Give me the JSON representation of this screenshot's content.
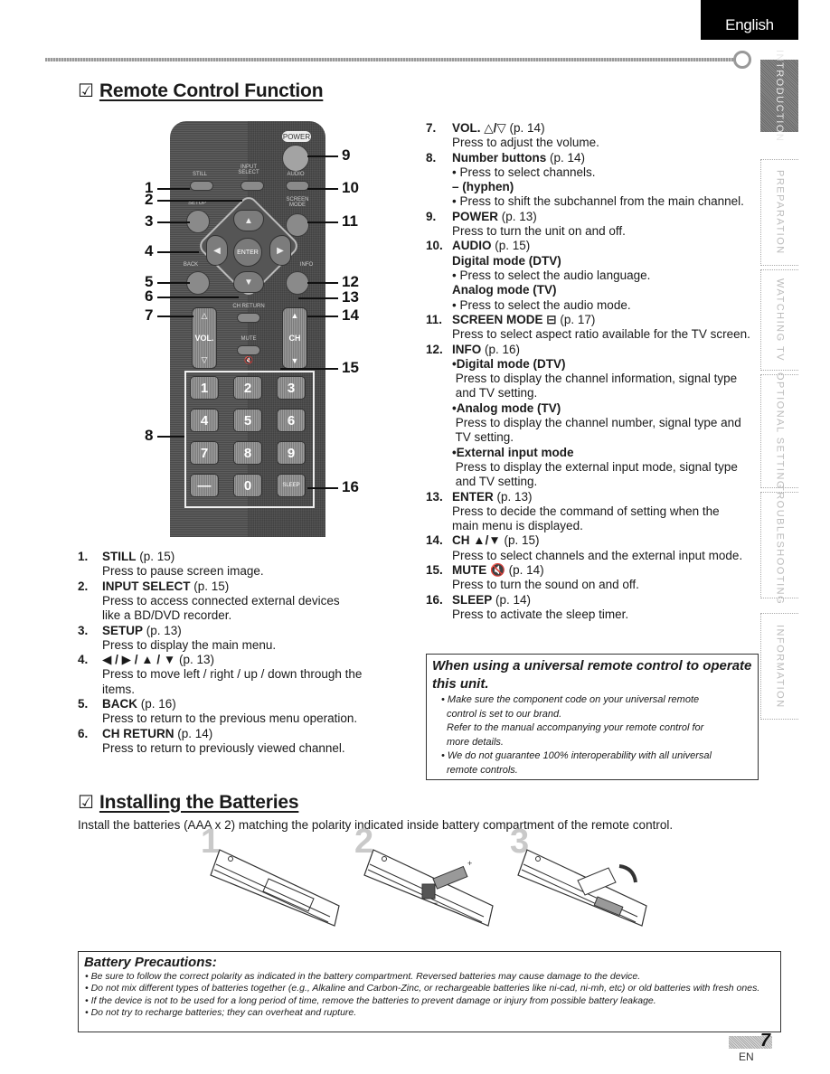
{
  "header": {
    "language": "English"
  },
  "side_nav": [
    {
      "label": "INTRODUCTION",
      "active": true
    },
    {
      "label": "PREPARATION",
      "active": false
    },
    {
      "label": "WATCHING TV",
      "active": false
    },
    {
      "label": "OPTIONAL SETTING",
      "active": false
    },
    {
      "label": "TROUBLESHOOTING",
      "active": false
    },
    {
      "label": "INFORMATION",
      "active": false
    }
  ],
  "remote_section": {
    "checkbox": "☑",
    "title": "Remote Control Function",
    "remote": {
      "power": "POWER",
      "still": "STILL",
      "input_select": "INPUT SELECT",
      "audio": "AUDIO",
      "setup": "SETUP",
      "screen_mode": "SCREEN MODE",
      "back": "BACK",
      "info": "INFO",
      "enter": "ENTER",
      "ch_return": "CH RETURN",
      "vol": "VOL.",
      "ch": "CH",
      "mute": "MUTE",
      "sleep": "SLEEP",
      "keys": [
        "1",
        "2",
        "3",
        "4",
        "5",
        "6",
        "7",
        "8",
        "9",
        "—",
        "0"
      ]
    },
    "callouts_left": [
      "1",
      "2",
      "3",
      "4",
      "5",
      "6",
      "7",
      "8"
    ],
    "callouts_right": [
      "9",
      "10",
      "11",
      "12",
      "13",
      "14",
      "15",
      "16"
    ],
    "items_left": [
      {
        "num": "1.",
        "name": "STILL",
        "page": "(p. 15)",
        "lines": [
          "Press to pause screen image."
        ]
      },
      {
        "num": "2.",
        "name": "INPUT SELECT",
        "page": "(p. 15)",
        "lines": [
          "Press to access connected external devices",
          "like a BD/DVD recorder."
        ]
      },
      {
        "num": "3.",
        "name": "SETUP",
        "page": "(p. 13)",
        "lines": [
          "Press to display the main menu."
        ]
      },
      {
        "num": "4.",
        "name": "◀ / ▶ / ▲ / ▼",
        "page": "(p. 13)",
        "lines": [
          "Press to move left / right / up / down through the",
          "items."
        ]
      },
      {
        "num": "5.",
        "name": "BACK",
        "page": "(p. 16)",
        "lines": [
          "Press to return to the previous menu operation."
        ]
      },
      {
        "num": "6.",
        "name": "CH RETURN",
        "page": "(p. 14)",
        "lines": [
          "Press to return to previously viewed channel."
        ]
      }
    ],
    "items_right": [
      {
        "num": "7.",
        "name": "VOL. △/▽",
        "page": "(p. 14)",
        "lines": [
          {
            "t": "Press to adjust the volume."
          }
        ]
      },
      {
        "num": "8.",
        "name": "Number buttons",
        "page": "(p. 14)",
        "lines": [
          {
            "t": "• Press to select channels."
          },
          {
            "t": "– (hyphen)",
            "b": true
          },
          {
            "t": "• Press to shift the subchannel from the main channel."
          }
        ]
      },
      {
        "num": "9.",
        "name": "POWER",
        "page": "(p. 13)",
        "lines": [
          {
            "t": "Press to turn the unit on and off."
          }
        ]
      },
      {
        "num": "10.",
        "name": "AUDIO",
        "page": "(p. 15)",
        "lines": [
          {
            "t": "Digital mode (DTV)",
            "b": true
          },
          {
            "t": "• Press to select the audio language."
          },
          {
            "t": "Analog mode (TV)",
            "b": true
          },
          {
            "t": "• Press to select the audio mode."
          }
        ]
      },
      {
        "num": "11.",
        "name": "SCREEN MODE ⊟",
        "page": "(p. 17)",
        "lines": [
          {
            "t": "Press to select aspect ratio available for the TV screen."
          }
        ]
      },
      {
        "num": "12.",
        "name": "INFO",
        "page": "(p. 16)",
        "lines": [
          {
            "t": "•Digital mode (DTV)",
            "b": true
          },
          {
            "t": " Press to display the channel information, signal type"
          },
          {
            "t": " and TV setting."
          },
          {
            "t": "•Analog mode (TV)",
            "b": true
          },
          {
            "t": " Press to display the channel number, signal type and"
          },
          {
            "t": " TV setting."
          },
          {
            "t": "•External input mode",
            "b": true
          },
          {
            "t": " Press to display the external input mode, signal type"
          },
          {
            "t": " and TV setting."
          }
        ]
      },
      {
        "num": "13.",
        "name": "ENTER",
        "page": "(p. 13)",
        "lines": [
          {
            "t": "Press to decide the command of setting when the"
          },
          {
            "t": "main menu is displayed."
          }
        ]
      },
      {
        "num": "14.",
        "name": "CH ▲/▼",
        "page": "(p. 15)",
        "lines": [
          {
            "t": "Press to select channels and the external input mode."
          }
        ]
      },
      {
        "num": "15.",
        "name": "MUTE 🔇",
        "page": "(p. 14)",
        "lines": [
          {
            "t": "Press to turn the sound on and off."
          }
        ]
      },
      {
        "num": "16.",
        "name": "SLEEP",
        "page": "(p. 14)",
        "lines": [
          {
            "t": "Press to activate the sleep timer."
          }
        ]
      }
    ],
    "universal_note": {
      "heading": "When using a universal remote control to operate this unit.",
      "lines": [
        "• Make sure the component code on your universal remote",
        "  control is set to our brand.",
        "  Refer to the manual accompanying your remote control for",
        "  more details.",
        "• We do not guarantee 100% interoperability with all universal",
        "  remote controls."
      ]
    }
  },
  "battery_section": {
    "checkbox": "☑",
    "title": "Installing the Batteries",
    "intro": "Install the batteries (AAA x 2) matching the polarity indicated inside battery compartment of the remote control.",
    "steps": [
      "1",
      "2",
      "3"
    ],
    "precautions": {
      "heading": "Battery Precautions:",
      "items": [
        "• Be sure to follow the correct polarity as indicated in the battery compartment. Reversed batteries may cause damage to the device.",
        "• Do not mix different types of batteries together (e.g., Alkaline and Carbon-Zinc, or rechargeable batteries like ni-cad, ni-mh, etc) or old batteries with fresh ones.",
        "• If the device is not to be used for a long period of time, remove the batteries to prevent damage or injury from possible battery leakage.",
        "• Do not try to recharge batteries; they can overheat and rupture."
      ]
    }
  },
  "footer": {
    "page_number": "7",
    "lang_code": "EN"
  }
}
